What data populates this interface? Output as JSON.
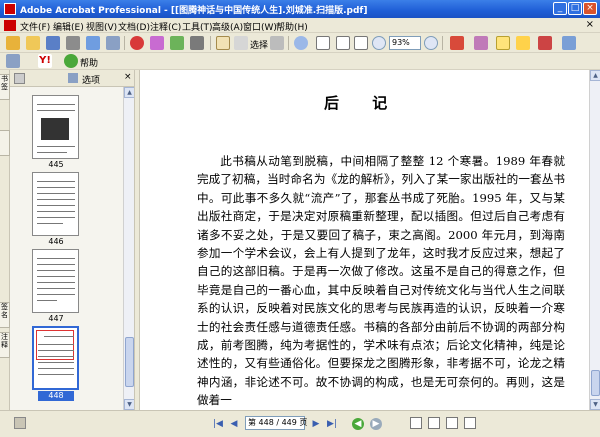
{
  "window": {
    "title": "Adobe Acrobat Professional - [[图腾神话与中国传统人生].刘城准.扫描版.pdf]",
    "minimize_label": "_",
    "maximize_label": "□",
    "close_label": "×"
  },
  "menu": {
    "items": [
      "文件(F)",
      "编辑(E)",
      "视图(V)",
      "文档(D)",
      "注释(C)",
      "工具(T)",
      "高级(A)",
      "窗口(W)",
      "帮助(H)"
    ],
    "doc_close": "×"
  },
  "toolbar": {
    "select_label": "选择",
    "zoom_value": "93%",
    "help_label": "帮助"
  },
  "navpanel": {
    "options_label": "选项",
    "tab_bookmarks": "书签",
    "tab_signatures": "签名",
    "tab_attachments": "注释",
    "thumbnails": [
      {
        "label": "445",
        "selected": false
      },
      {
        "label": "446",
        "selected": false
      },
      {
        "label": "447",
        "selected": false
      },
      {
        "label": "448",
        "selected": true
      }
    ]
  },
  "document": {
    "heading": "后 记",
    "body": "此书稿从动笔到脱稿，中间相隔了整整 12 个寒暑。1989 年春就完成了初稿，当时命名为《龙的解析》，列入了某一家出版社的一套丛书中。可此事不多久就“流产”了，那套丛书成了死胎。1995 年，又与某出版社商定，于是决定对原稿重新整理，配以插图。但过后自己考虑有诸多不妥之处，于是又要回了稿子，束之高阁。2000 年元月，到海南参加一个学术会议，会上有人提到了龙年，这时我才反应过来，想起了自己的这部旧稿。于是再一次做了修改。这虽不是自己的得意之作，但毕竟是自己的一番心血，其中反映着自己对传统文化与当代人生之间联系的认识，反映着对民族文化的思考与民族再造的认识，反映着一介寒士的社会责任感与道德责任感。书稿的各部分由前后不协调的两部分构成，前考图腾，纯为考据性的，学术味有点浓；后论文化精神，纯是论述性的，又有些通俗化。但要探龙之图腾形象，非考据不可，论龙之精神内涵，非论述不可。故不协调的构成，也是无可奈何的。再则，这是做着一"
  },
  "status": {
    "page_display": "第 448 / 449 页"
  },
  "colors": {
    "titlebar": "#1f5ed6",
    "chrome": "#ece9d8",
    "selection": "#3168d5"
  }
}
